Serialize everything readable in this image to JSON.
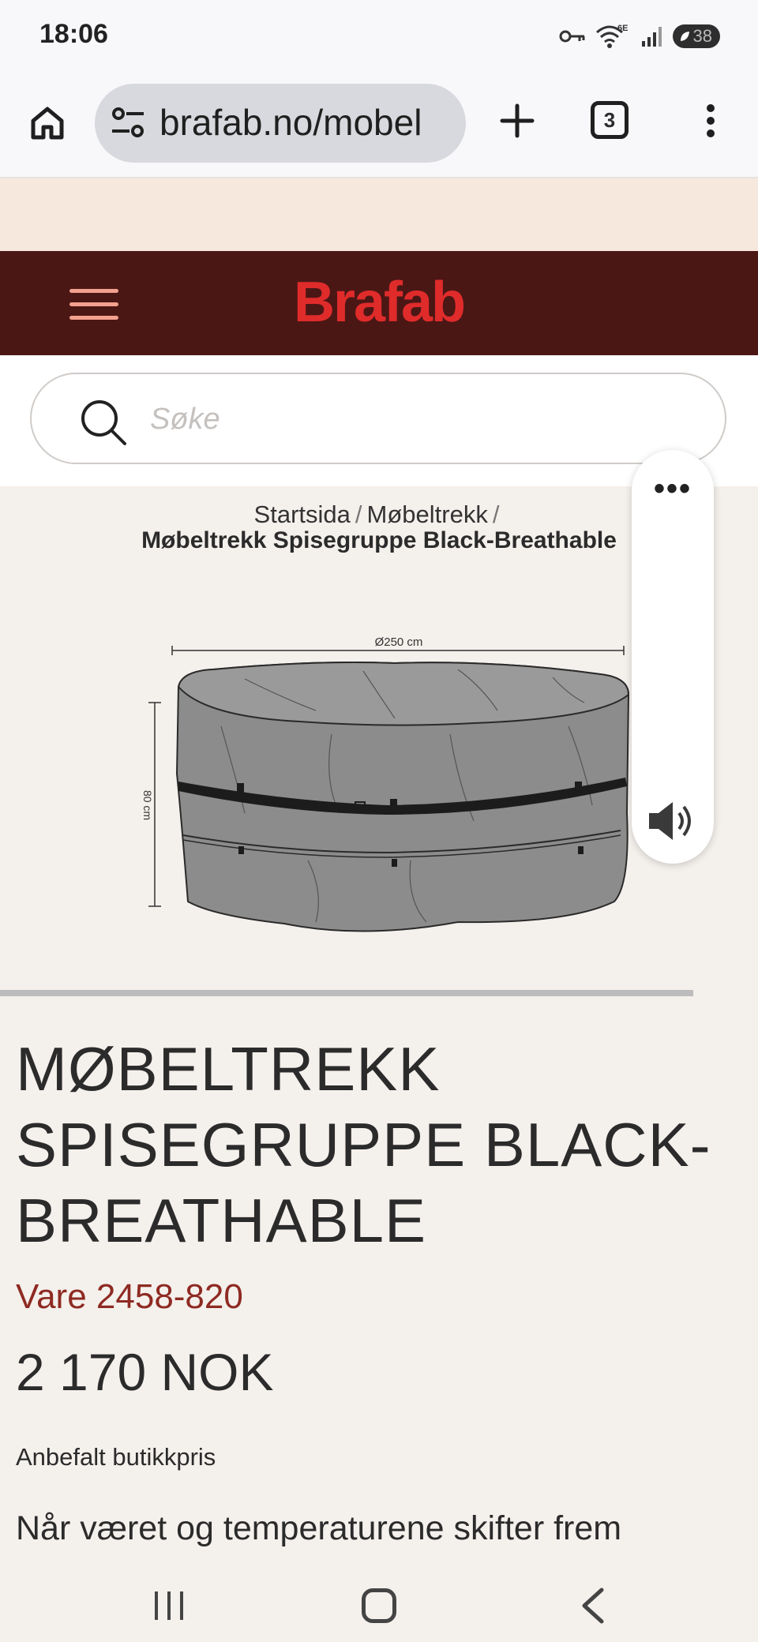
{
  "status_bar": {
    "time": "18:06",
    "network_label": "6E",
    "battery_level": "38",
    "icons": [
      "vpn-key-icon",
      "wifi-6e-icon",
      "signal-icon",
      "battery-icon"
    ]
  },
  "browser": {
    "url": "brafab.no/mobel",
    "tab_count": "3",
    "icons": [
      "home-icon",
      "site-settings-icon",
      "plus-icon",
      "tabs-icon",
      "more-vert-icon"
    ]
  },
  "site": {
    "brand": "Brafab",
    "brand_color": "#e02b2b",
    "header_color": "#4b1715",
    "search_placeholder": "Søke"
  },
  "breadcrumb": {
    "items": [
      "Startsida",
      "Møbeltrekk"
    ],
    "separator": "/",
    "current": "Møbeltrekk Spisegruppe Black-Breathable"
  },
  "product_image": {
    "diameter_label": "Ø250 cm",
    "height_label": "80 cm"
  },
  "product": {
    "title_lines": [
      "MØBELTREKK",
      "SPISEGRUPPE BLACK-",
      "BREATHABLE"
    ],
    "sku": "Vare 2458-820",
    "price": "2 170 NOK",
    "price_note": "Anbefalt butikkpris",
    "description_start": "Når været og temperaturene skifter frem"
  },
  "floating_panel": {
    "more_label": "•••",
    "icons": [
      "more-horiz-icon",
      "speaker-icon"
    ]
  },
  "nav_bar": {
    "icons": [
      "recents-icon",
      "home-circle-icon",
      "back-icon"
    ]
  }
}
